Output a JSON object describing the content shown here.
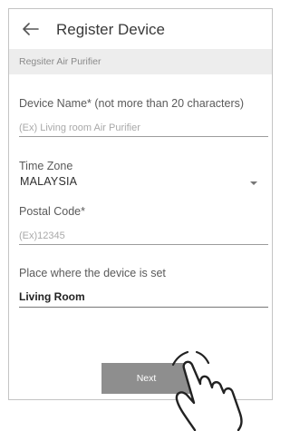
{
  "header": {
    "back_icon": "back-arrow-icon",
    "title": "Register Device"
  },
  "section": {
    "title": "Regsiter Air Purifier"
  },
  "form": {
    "device_name": {
      "label": "Device Name* (not more than 20 characters)",
      "placeholder": "(Ex) Living room Air Purifier"
    },
    "time_zone": {
      "label": "Time Zone",
      "value": "MALAYSIA",
      "options": [
        "MALAYSIA"
      ]
    },
    "postal_code": {
      "label": "Postal Code*",
      "placeholder": "(Ex)12345"
    },
    "place": {
      "label": "Place where the device is set",
      "value": "Living Room"
    }
  },
  "actions": {
    "next_label": "Next"
  },
  "overlay": {
    "icon": "tap-hand-icon"
  },
  "colors": {
    "section_bg": "#ededed",
    "button_bg": "#8e8e8e",
    "button_text": "#ffffff"
  }
}
